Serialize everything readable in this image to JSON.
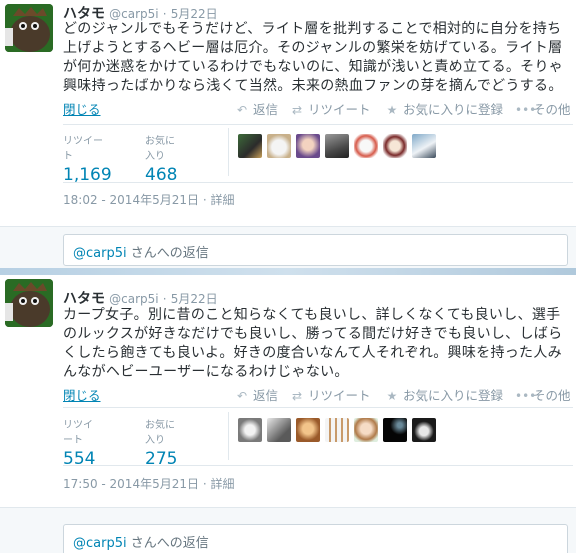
{
  "tweets": [
    {
      "fullname": "ハタモ",
      "username": "@carp5i",
      "sep": "·",
      "date": "5月22日",
      "text": "どのジャンルでもそうだけど、ライト層を批判することで相対的に自分を持ち上げようとするヘビー層は厄介。そのジャンルの繁栄を妨げている。ライト層が何か迷惑をかけているわけでもないのに、知識が浅いと責め立てる。そりゃ興味持ったばかりなら浅くて当然。未来の熱血ファンの芽を摘んでどうする。",
      "close": "閉じる",
      "reply": "返信",
      "retweet": "リツイート",
      "favorite": "お気に入りに登録",
      "more": "その他",
      "retweets_label": "リツイート",
      "retweets_count": "1,169",
      "favorites_label": "お気に入り",
      "favorites_count": "468",
      "time": "18:02 - 2014年5月21日",
      "detail": "詳細",
      "reply_mention": "@carp5i",
      "reply_suffix": " さんへの返信"
    },
    {
      "fullname": "ハタモ",
      "username": "@carp5i",
      "sep": "·",
      "date": "5月22日",
      "text": "カープ女子。別に昔のこと知らなくても良いし、詳しくなくても良いし、選手のルックスが好きなだけでも良いし、勝ってる間だけ好きでも良いし、しばらくしたら飽きても良いよ。好きの度合いなんて人それぞれ。興味を持った人みんながヘビーユーザーになるわけじゃない。",
      "close": "閉じる",
      "reply": "返信",
      "retweet": "リツイート",
      "favorite": "お気に入りに登録",
      "more": "その他",
      "retweets_label": "リツイート",
      "retweets_count": "554",
      "favorites_label": "お気に入り",
      "favorites_count": "275",
      "time": "17:50 - 2014年5月21日",
      "detail": "詳細",
      "reply_mention": "@carp5i",
      "reply_suffix": " さんへの返信"
    }
  ],
  "icons": {
    "reply": "reply-arrow-icon",
    "retweet": "retweet-icon",
    "favorite": "star-icon",
    "more": "dots-icon"
  },
  "colors": {
    "link": "#0084b4",
    "muted": "#8899a6",
    "text": "#292f33"
  }
}
